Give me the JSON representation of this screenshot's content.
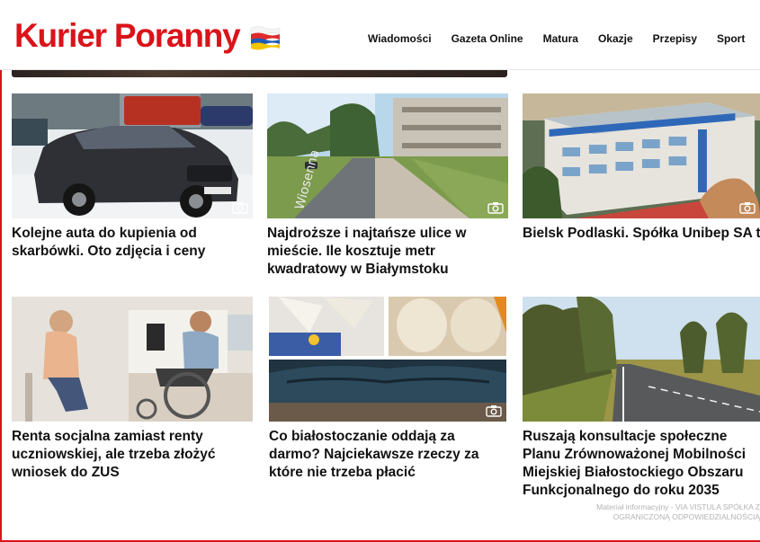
{
  "header": {
    "logo_text": "Kurier Poranny",
    "nav": [
      "Wiadomości",
      "Gazeta Online",
      "Matura",
      "Okazje",
      "Przepisy",
      "Sport"
    ]
  },
  "articles": [
    {
      "title": "Kolejne auta do kupienia od skarbówki. Oto zdjęcia i ceny"
    },
    {
      "title": "Najdroższe i najtańsze ulice w mieście. Ile kosztuje metr kwadratowy w Białymstoku"
    },
    {
      "title": "Bielsk Podlaski. Spółka Unibep SA teraz z pięcioosobowym zarządem"
    },
    {
      "title": "Renta socjalna zamiast renty uczniowskiej, ale trzeba złożyć wniosek do ZUS"
    },
    {
      "title": "Co białostoczanie oddają za darmo? Najciekawsze rzeczy za które nie trzeba płacić"
    },
    {
      "title": "Ruszają konsultacje społeczne Planu Zrównoważonej Mobilności Miejskiej Białostockiego Obszaru Funkcjonalnego do roku 2035"
    }
  ],
  "sponsor_note": {
    "line1": "Materiał informacyjny - VIA VISTULA SPÓŁKA Z",
    "line2": "OGRANICZONĄ ODPOWIEDZIALNOŚCIĄ"
  },
  "colors": {
    "brand_red": "#d9141a"
  },
  "icons": {
    "gallery": "camera-icon",
    "flag": "poland-ukraine-flag-icon"
  }
}
